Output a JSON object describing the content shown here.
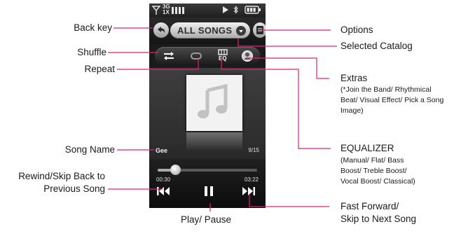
{
  "status_bar": {
    "network_label": "3G\n1X",
    "icons": [
      "signal-icon",
      "network-icon",
      "signal-bars-icon",
      "play-icon",
      "bluetooth-icon",
      "battery-icon"
    ]
  },
  "player": {
    "catalog_label": "ALL SONGS",
    "song_name": "Gee",
    "track_counter": "9/15",
    "time_elapsed": "00:30",
    "time_total": "03:22",
    "progress": 0.18,
    "toolbar_eq_label": "EQ"
  },
  "callouts": {
    "back_key": "Back key",
    "shuffle": "Shuffle",
    "repeat": "Repeat",
    "song_name": "Song Name",
    "rewind_line1": "Rewind/Skip Back to",
    "rewind_line2": "Previous Song",
    "play_pause": "Play/ Pause",
    "options": "Options",
    "selected_catalog": "Selected Catalog",
    "extras": "Extras",
    "extras_desc_1": "(*Join the Band/ Rhythmical",
    "extras_desc_2": "Beat/ Visual Effect/ Pick a Song",
    "extras_desc_3": "Image)",
    "equalizer": "EQUALIZER",
    "equalizer_desc_1": "(Manual/ Flat/ Bass",
    "equalizer_desc_2": "Boost/ Treble Boost/",
    "equalizer_desc_3": "Vocal Boost/ Classical)",
    "ff_line1": "Fast Forward/",
    "ff_line2": "Skip to Next Song"
  },
  "colors": {
    "callout_line": "#e0207a",
    "screen_bg": "#1b1b1b",
    "text": "#1a1a1a"
  }
}
